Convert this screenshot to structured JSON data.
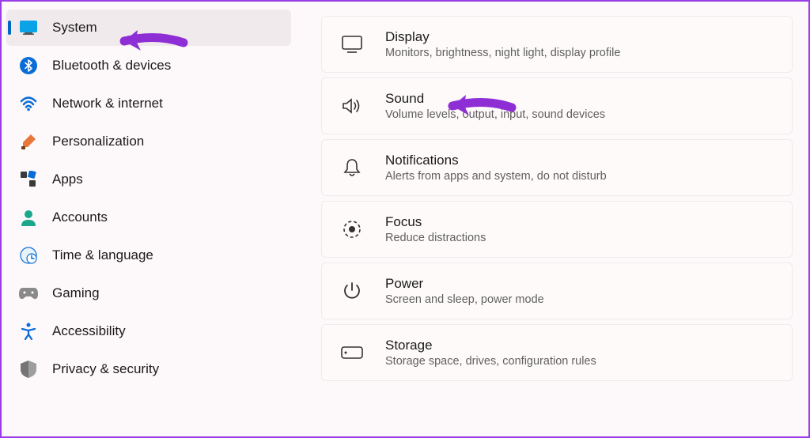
{
  "sidebar": {
    "items": [
      {
        "key": "system",
        "label": "System",
        "active": true
      },
      {
        "key": "bluetooth",
        "label": "Bluetooth & devices",
        "active": false
      },
      {
        "key": "network",
        "label": "Network & internet",
        "active": false
      },
      {
        "key": "personalization",
        "label": "Personalization",
        "active": false
      },
      {
        "key": "apps",
        "label": "Apps",
        "active": false
      },
      {
        "key": "accounts",
        "label": "Accounts",
        "active": false
      },
      {
        "key": "time",
        "label": "Time & language",
        "active": false
      },
      {
        "key": "gaming",
        "label": "Gaming",
        "active": false
      },
      {
        "key": "accessibility",
        "label": "Accessibility",
        "active": false
      },
      {
        "key": "privacy",
        "label": "Privacy & security",
        "active": false
      }
    ]
  },
  "main": {
    "cards": [
      {
        "key": "display",
        "title": "Display",
        "desc": "Monitors, brightness, night light, display profile"
      },
      {
        "key": "sound",
        "title": "Sound",
        "desc": "Volume levels, output, input, sound devices"
      },
      {
        "key": "notifications",
        "title": "Notifications",
        "desc": "Alerts from apps and system, do not disturb"
      },
      {
        "key": "focus",
        "title": "Focus",
        "desc": "Reduce distractions"
      },
      {
        "key": "power",
        "title": "Power",
        "desc": "Screen and sleep, power mode"
      },
      {
        "key": "storage",
        "title": "Storage",
        "desc": "Storage space, drives, configuration rules"
      }
    ]
  },
  "annotations": {
    "arrow_color": "#8e2fd6"
  }
}
